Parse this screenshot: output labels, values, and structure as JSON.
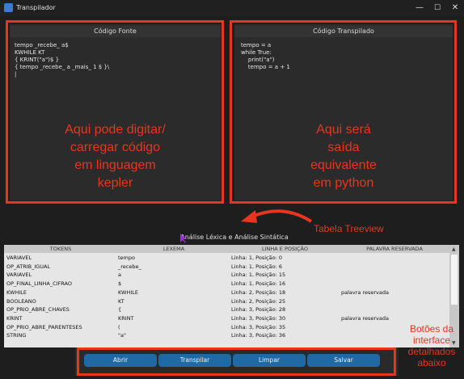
{
  "window": {
    "title": "Transpilador",
    "minimize": "—",
    "maximize": "☐",
    "close": "✕"
  },
  "source_panel": {
    "header": "Código Fonte",
    "code": "tempo _recebe_ a$\nKWHILE KT\n{ KRINT(\"a\")$ }\n{ tempo _recebe_ a _mais_ 1 $ }\\\n|"
  },
  "target_panel": {
    "header": "Código Transpilado",
    "code": "tempo = a\nwhile True:\n    print(\"a\")\n    tempo = a + 1"
  },
  "annotations": {
    "source": "Aqui pode digitar/\ncarregar código\nem linguagem\nkepler",
    "target": "Aqui será\nsaída\nequivalente\nem python",
    "treeview": "Tabela Treeview",
    "buttons": "Botões da\ninterface\ndetalhados\nabaixo"
  },
  "analysis": {
    "title": "Análise Léxica e Análise Sintática",
    "columns": [
      "TOKENS",
      "LEXEMA",
      "LINHA E POSIÇÃO",
      "PALAVRA RESERVADA"
    ],
    "rows": [
      [
        "VARIAVEL",
        "tempo",
        "Linha: 1, Posição: 0",
        ""
      ],
      [
        "OP_ATRIB_IGUAL",
        "_recebe_",
        "Linha: 1, Posição: 6",
        ""
      ],
      [
        "VARIAVEL",
        "a",
        "Linha: 1, Posição: 15",
        ""
      ],
      [
        "OP_FINAL_LINHA_CIFRAO",
        "$",
        "Linha: 1, Posição: 16",
        ""
      ],
      [
        "KWHILE",
        "KWHILE",
        "Linha: 2, Posição: 18",
        "palavra reservada"
      ],
      [
        "BOOLEANO",
        "KT",
        "Linha: 2, Posição: 25",
        ""
      ],
      [
        "OP_PRIO_ABRE_CHAVES",
        "{",
        "Linha: 3, Posição: 28",
        ""
      ],
      [
        "KRINT",
        "KRINT",
        "Linha: 3, Posição: 30",
        "palavra reservada"
      ],
      [
        "OP_PRIO_ABRE_PARENTESES",
        "(",
        "Linha: 3, Posição: 35",
        ""
      ],
      [
        "STRING",
        "\"a\"",
        "Linha: 3, Posição: 36",
        ""
      ]
    ]
  },
  "buttons": {
    "open": "Abrir",
    "transpile": "Transpilar",
    "clear": "Limpar",
    "save": "Salvar"
  },
  "colors": {
    "annotation_red": "#e8351f",
    "button_blue": "#1f6aa5",
    "cursor_purple": "#9b30d9"
  }
}
